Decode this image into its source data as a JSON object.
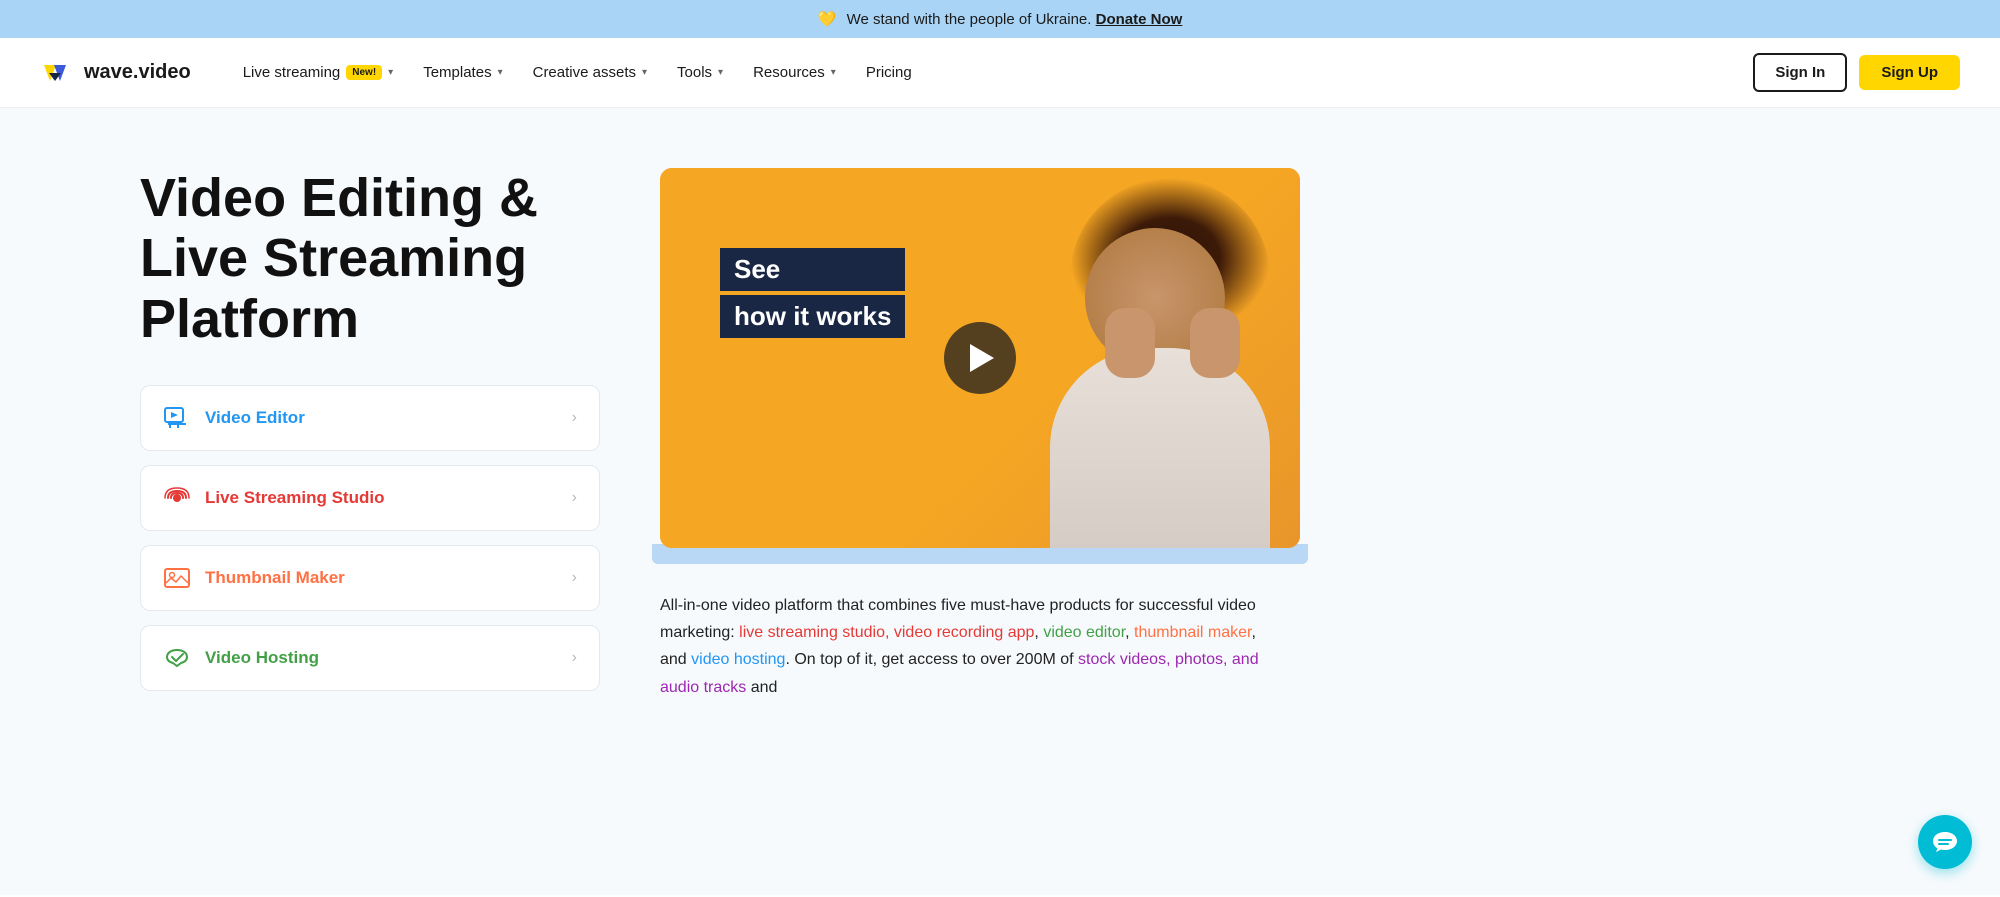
{
  "banner": {
    "emoji": "💛",
    "text": "We stand with the people of Ukraine.",
    "link_text": "Donate Now"
  },
  "nav": {
    "logo_text": "wave.video",
    "items": [
      {
        "label": "Live streaming",
        "badge": "New!",
        "has_dropdown": true
      },
      {
        "label": "Templates",
        "has_dropdown": true
      },
      {
        "label": "Creative assets",
        "has_dropdown": true
      },
      {
        "label": "Tools",
        "has_dropdown": true
      },
      {
        "label": "Resources",
        "has_dropdown": true
      },
      {
        "label": "Pricing",
        "has_dropdown": false
      }
    ],
    "signin_label": "Sign In",
    "signup_label": "Sign Up"
  },
  "hero": {
    "title": "Video Editing & Live Streaming Platform"
  },
  "features": [
    {
      "id": "video-editor",
      "label": "Video Editor",
      "color": "blue"
    },
    {
      "id": "live-streaming",
      "label": "Live Streaming Studio",
      "color": "red"
    },
    {
      "id": "thumbnail-maker",
      "label": "Thumbnail Maker",
      "color": "orange"
    },
    {
      "id": "video-hosting",
      "label": "Video Hosting",
      "color": "green"
    }
  ],
  "video_badge": {
    "line1": "See",
    "line2": "how it works"
  },
  "description": {
    "intro": "All-in-one video platform that combines five must-have products for successful video marketing: ",
    "link1": "live streaming studio, video recording app",
    "comma1": ", ",
    "link2": "video editor",
    "comma2": ", ",
    "link3": "thumbnail maker",
    "and_text": ", and ",
    "link4": "video hosting",
    "outro": ". On top of it, get access to over 200M of ",
    "link5": "stock videos, photos, and audio tracks",
    "end": " and"
  }
}
